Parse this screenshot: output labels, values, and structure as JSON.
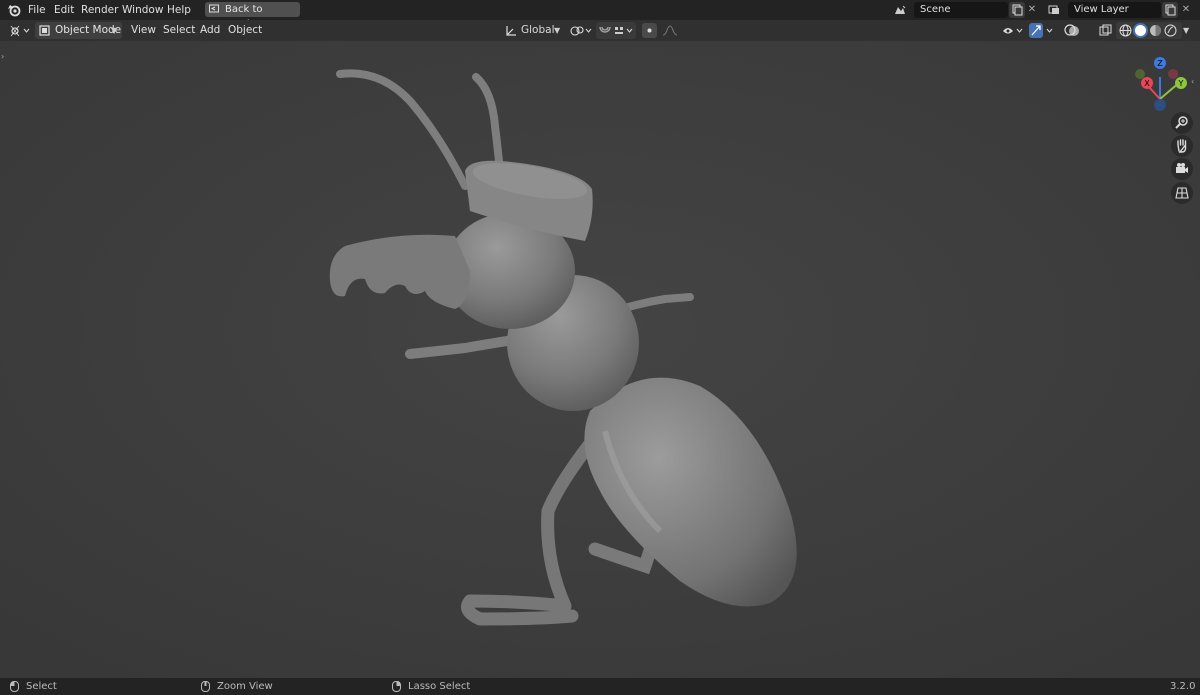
{
  "topbar": {
    "logo_icon": "blender-logo-icon",
    "menus": [
      "File",
      "Edit",
      "Render",
      "Window",
      "Help"
    ],
    "back_button": "Back to Previous",
    "scene_field": "Scene",
    "view_layer_field": "View Layer"
  },
  "header": {
    "editor_type_icon": "3d-viewport-icon",
    "mode": "Object Mode",
    "menus": [
      "View",
      "Select",
      "Add",
      "Object"
    ],
    "transform_orientation": "Global"
  },
  "viewport": {
    "gizmo_axes": [
      "Z",
      "X",
      "Y"
    ],
    "axis_colors": {
      "x": "#e8475a",
      "y": "#8cc63f",
      "z": "#3d7be0"
    },
    "nav_icons": [
      "zoom-icon",
      "pan-hand-icon",
      "camera-icon",
      "grid-perspective-icon"
    ]
  },
  "statusbar": {
    "select": "Select",
    "zoom_view": "Zoom View",
    "lasso_select": "Lasso Select",
    "version": "3.2.0"
  }
}
